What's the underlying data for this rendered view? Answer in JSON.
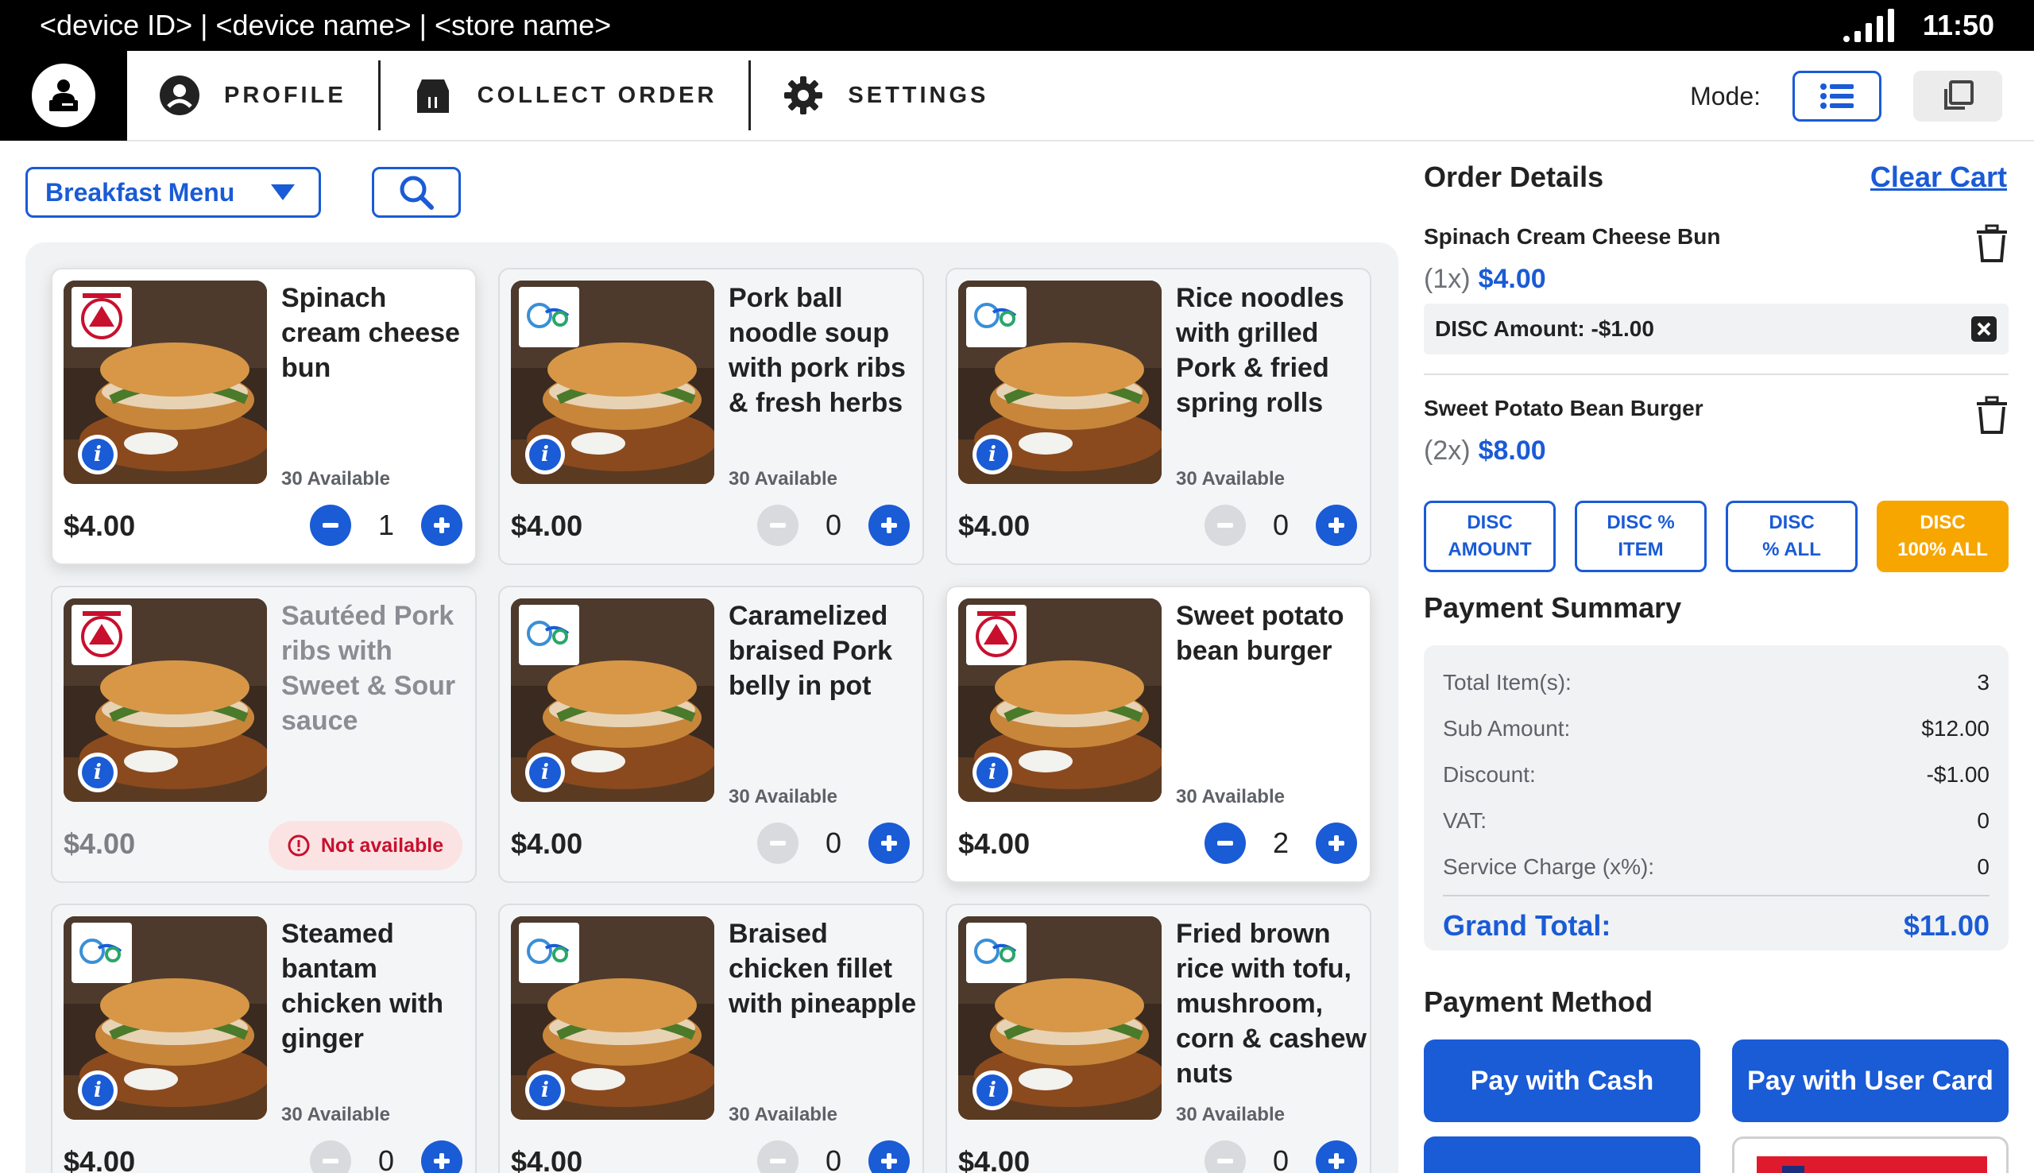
{
  "status_bar": {
    "device_info": "<device ID> | <device name> | <store name>",
    "time": "11:50"
  },
  "nav": {
    "profile": "PROFILE",
    "collect_order": "COLLECT ORDER",
    "settings": "SETTINGS",
    "mode_label": "Mode:"
  },
  "toolbar": {
    "menu_selected": "Breakfast Menu"
  },
  "products": [
    {
      "name": "Spinach cream cheese bun",
      "available": "30 Available",
      "price": "$4.00",
      "qty": "1",
      "state": "selected",
      "badge": "red"
    },
    {
      "name": "Pork ball noodle soup with pork ribs & fresh herbs",
      "available": "30 Available",
      "price": "$4.00",
      "qty": "0",
      "state": "normal",
      "badge": "blue"
    },
    {
      "name": "Rice noodles with grilled Pork & fried spring rolls",
      "available": "30 Available",
      "price": "$4.00",
      "qty": "0",
      "state": "normal",
      "badge": "blue"
    },
    {
      "name": "Sautéed Pork ribs with Sweet & Sour sauce",
      "available": "",
      "price": "$4.00",
      "qty": "",
      "state": "unavailable",
      "badge": "red",
      "status": "Not available"
    },
    {
      "name": "Caramelized braised Pork belly in pot",
      "available": "30 Available",
      "price": "$4.00",
      "qty": "0",
      "state": "normal",
      "badge": "blue"
    },
    {
      "name": "Sweet potato bean burger",
      "available": "30 Available",
      "price": "$4.00",
      "qty": "2",
      "state": "selected",
      "badge": "red"
    },
    {
      "name": "Steamed bantam chicken with ginger",
      "available": "30 Available",
      "price": "$4.00",
      "qty": "0",
      "state": "normal",
      "badge": "blue"
    },
    {
      "name": "Braised chicken fillet with pineapple",
      "available": "30 Available",
      "price": "$4.00",
      "qty": "0",
      "state": "normal",
      "badge": "blue"
    },
    {
      "name": "Fried brown rice with tofu, mushroom, corn & cashew nuts",
      "available": "30 Available",
      "price": "$4.00",
      "qty": "0",
      "state": "normal",
      "badge": "blue"
    }
  ],
  "order": {
    "title": "Order Details",
    "clear_cart": "Clear Cart",
    "items": [
      {
        "name": "Spinach Cream Cheese Bun",
        "qty": "(1x)",
        "amount": "$4.00"
      },
      {
        "name": "Sweet Potato Bean Burger",
        "qty": "(2x)",
        "amount": "$8.00"
      }
    ],
    "discount_line": "DISC Amount: -$1.00"
  },
  "discount_buttons": [
    {
      "line1": "DISC",
      "line2": "AMOUNT"
    },
    {
      "line1": "DISC %",
      "line2": "ITEM"
    },
    {
      "line1": "DISC",
      "line2": "% ALL"
    },
    {
      "line1": "DISC",
      "line2": "100% ALL"
    }
  ],
  "payment_summary": {
    "title": "Payment Summary",
    "rows": [
      {
        "label": "Total Item(s):",
        "value": "3"
      },
      {
        "label": "Sub Amount:",
        "value": "$12.00"
      },
      {
        "label": "Discount:",
        "value": "-$1.00"
      },
      {
        "label": "VAT:",
        "value": "0"
      },
      {
        "label": "Service Charge (x%):",
        "value": "0"
      }
    ],
    "grand_total_label": "Grand Total:",
    "grand_total_value": "$11.00"
  },
  "payment_method": {
    "title": "Payment Method",
    "cash": "Pay with Cash",
    "user_card": "Pay with User Card"
  },
  "colors": {
    "primary": "#1a5bd6",
    "accent": "#f7a600",
    "danger": "#c8102e"
  }
}
